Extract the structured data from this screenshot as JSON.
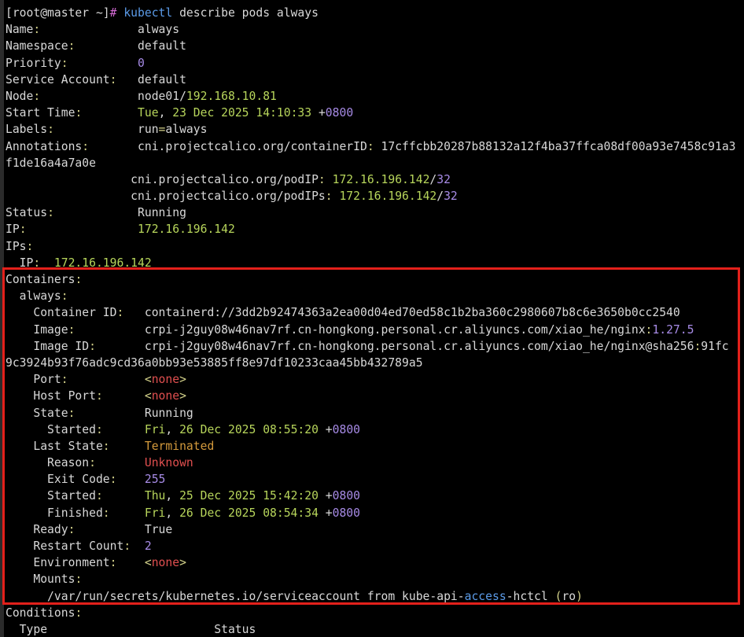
{
  "colors": {
    "background": "#000000",
    "text": "#d8d8d8",
    "label": "#d4d28a",
    "ip_green": "#b7d55b",
    "number_purple": "#a78be6",
    "command_blue": "#5b9be8",
    "terminated_orange": "#d49a3c",
    "unknown_red": "#e04f4f",
    "highlight_box": "#e3201b"
  },
  "terminal": {
    "lines": [
      [
        {
          "t": "[root@master ~]",
          "c": "w"
        },
        {
          "t": "# ",
          "c": "m"
        },
        {
          "t": "kubectl",
          "c": "b"
        },
        {
          "t": " describe pods always",
          "c": "w"
        }
      ],
      [
        {
          "t": "Name",
          "c": "w"
        },
        {
          "t": ":",
          "c": "y"
        },
        {
          "t": "              always",
          "c": "w"
        }
      ],
      [
        {
          "t": "Namespace",
          "c": "w"
        },
        {
          "t": ":",
          "c": "y"
        },
        {
          "t": "         default",
          "c": "w"
        }
      ],
      [
        {
          "t": "Priority",
          "c": "w"
        },
        {
          "t": ":",
          "c": "y"
        },
        {
          "t": "          ",
          "c": "w"
        },
        {
          "t": "0",
          "c": "p"
        }
      ],
      [
        {
          "t": "Service Account",
          "c": "w"
        },
        {
          "t": ":",
          "c": "y"
        },
        {
          "t": "   default",
          "c": "w"
        }
      ],
      [
        {
          "t": "Node",
          "c": "w"
        },
        {
          "t": ":",
          "c": "y"
        },
        {
          "t": "              node01/",
          "c": "w"
        },
        {
          "t": "192.168.10.81",
          "c": "g"
        }
      ],
      [
        {
          "t": "Start Time",
          "c": "w"
        },
        {
          "t": ":",
          "c": "y"
        },
        {
          "t": "        ",
          "c": "w"
        },
        {
          "t": "Tue",
          "c": "g"
        },
        {
          "t": ", ",
          "c": "w"
        },
        {
          "t": "23 Dec 2025 14:10:33",
          "c": "g"
        },
        {
          "t": " +",
          "c": "w"
        },
        {
          "t": "0800",
          "c": "p"
        }
      ],
      [
        {
          "t": "Labels",
          "c": "w"
        },
        {
          "t": ":",
          "c": "y"
        },
        {
          "t": "            run",
          "c": "w"
        },
        {
          "t": "=",
          "c": "y"
        },
        {
          "t": "always",
          "c": "w"
        }
      ],
      [
        {
          "t": "Annotations",
          "c": "w"
        },
        {
          "t": ":",
          "c": "y"
        },
        {
          "t": "       cni.projectcalico.org/containerID",
          "c": "w"
        },
        {
          "t": ": ",
          "c": "y"
        },
        {
          "t": "17cffcbb20287b88132a12f4ba37ffca08df00a93e7458c91a3",
          "c": "w"
        }
      ],
      [
        {
          "t": "f1de16a4a7a0e",
          "c": "w"
        }
      ],
      [
        {
          "t": "                  cni.projectcalico.org/podIP",
          "c": "w"
        },
        {
          "t": ": ",
          "c": "y"
        },
        {
          "t": "172.16.196.142",
          "c": "g"
        },
        {
          "t": "/",
          "c": "w"
        },
        {
          "t": "32",
          "c": "p"
        }
      ],
      [
        {
          "t": "                  cni.projectcalico.org/podIPs",
          "c": "w"
        },
        {
          "t": ": ",
          "c": "y"
        },
        {
          "t": "172.16.196.142",
          "c": "g"
        },
        {
          "t": "/",
          "c": "w"
        },
        {
          "t": "32",
          "c": "p"
        }
      ],
      [
        {
          "t": "Status",
          "c": "w"
        },
        {
          "t": ":",
          "c": "y"
        },
        {
          "t": "            Running",
          "c": "w"
        }
      ],
      [
        {
          "t": "IP",
          "c": "w"
        },
        {
          "t": ":",
          "c": "y"
        },
        {
          "t": "                ",
          "c": "w"
        },
        {
          "t": "172.16.196.142",
          "c": "g"
        }
      ],
      [
        {
          "t": "IPs",
          "c": "w"
        },
        {
          "t": ":",
          "c": "y"
        }
      ],
      [
        {
          "t": "  IP",
          "c": "w"
        },
        {
          "t": ":",
          "c": "y"
        },
        {
          "t": "  ",
          "c": "w"
        },
        {
          "t": "172.16.196.142",
          "c": "g"
        }
      ],
      [
        {
          "t": "Containers",
          "c": "w"
        },
        {
          "t": ":",
          "c": "y"
        }
      ],
      [
        {
          "t": "  always",
          "c": "w"
        },
        {
          "t": ":",
          "c": "y"
        }
      ],
      [
        {
          "t": "    Container ID",
          "c": "w"
        },
        {
          "t": ":",
          "c": "y"
        },
        {
          "t": "   containerd://3dd2b92474363a2ea00d04ed70ed58c1b2ba360c2980607b8c6e3650b0cc2540",
          "c": "w"
        }
      ],
      [
        {
          "t": "    Image",
          "c": "w"
        },
        {
          "t": ":",
          "c": "y"
        },
        {
          "t": "          crpi-j2guy08w46nav7rf.cn-hongkong.personal.cr.aliyuncs.com/xiao_he/nginx",
          "c": "w"
        },
        {
          "t": ":",
          "c": "y"
        },
        {
          "t": "1.27.5",
          "c": "p"
        }
      ],
      [
        {
          "t": "    Image ID",
          "c": "w"
        },
        {
          "t": ":",
          "c": "y"
        },
        {
          "t": "       crpi-j2guy08w46nav7rf.cn-hongkong.personal.cr.aliyuncs.com/xiao_he/nginx@sha256",
          "c": "w"
        },
        {
          "t": ":",
          "c": "y"
        },
        {
          "t": "91fc",
          "c": "w"
        }
      ],
      [
        {
          "t": "9c3924b93f76adc9cd36a0bb93e53885ff8e97df10233caa45bb432789a5",
          "c": "w"
        }
      ],
      [
        {
          "t": "    Port",
          "c": "w"
        },
        {
          "t": ":",
          "c": "y"
        },
        {
          "t": "           ",
          "c": "w"
        },
        {
          "t": "<",
          "c": "y"
        },
        {
          "t": "none",
          "c": "r"
        },
        {
          "t": ">",
          "c": "y"
        }
      ],
      [
        {
          "t": "    Host Port",
          "c": "w"
        },
        {
          "t": ":",
          "c": "y"
        },
        {
          "t": "      ",
          "c": "w"
        },
        {
          "t": "<",
          "c": "y"
        },
        {
          "t": "none",
          "c": "r"
        },
        {
          "t": ">",
          "c": "y"
        }
      ],
      [
        {
          "t": "    State",
          "c": "w"
        },
        {
          "t": ":",
          "c": "y"
        },
        {
          "t": "          Running",
          "c": "w"
        }
      ],
      [
        {
          "t": "      Started",
          "c": "w"
        },
        {
          "t": ":",
          "c": "y"
        },
        {
          "t": "      ",
          "c": "w"
        },
        {
          "t": "Fri",
          "c": "g"
        },
        {
          "t": ", ",
          "c": "w"
        },
        {
          "t": "26 Dec 2025 08:55:20",
          "c": "g"
        },
        {
          "t": " +",
          "c": "w"
        },
        {
          "t": "0800",
          "c": "p"
        }
      ],
      [
        {
          "t": "    Last State",
          "c": "w"
        },
        {
          "t": ":",
          "c": "y"
        },
        {
          "t": "     ",
          "c": "w"
        },
        {
          "t": "Terminated",
          "c": "o"
        }
      ],
      [
        {
          "t": "      Reason",
          "c": "w"
        },
        {
          "t": ":",
          "c": "y"
        },
        {
          "t": "       ",
          "c": "w"
        },
        {
          "t": "Unknown",
          "c": "r"
        }
      ],
      [
        {
          "t": "      Exit Code",
          "c": "w"
        },
        {
          "t": ":",
          "c": "y"
        },
        {
          "t": "    ",
          "c": "w"
        },
        {
          "t": "255",
          "c": "p"
        }
      ],
      [
        {
          "t": "      Started",
          "c": "w"
        },
        {
          "t": ":",
          "c": "y"
        },
        {
          "t": "      ",
          "c": "w"
        },
        {
          "t": "Thu",
          "c": "g"
        },
        {
          "t": ", ",
          "c": "w"
        },
        {
          "t": "25 Dec 2025 15:42:20",
          "c": "g"
        },
        {
          "t": " +",
          "c": "w"
        },
        {
          "t": "0800",
          "c": "p"
        }
      ],
      [
        {
          "t": "      Finished",
          "c": "w"
        },
        {
          "t": ":",
          "c": "y"
        },
        {
          "t": "     ",
          "c": "w"
        },
        {
          "t": "Fri",
          "c": "g"
        },
        {
          "t": ", ",
          "c": "w"
        },
        {
          "t": "26 Dec 2025 08:54:34",
          "c": "g"
        },
        {
          "t": " +",
          "c": "w"
        },
        {
          "t": "0800",
          "c": "p"
        }
      ],
      [
        {
          "t": "    Ready",
          "c": "w"
        },
        {
          "t": ":",
          "c": "y"
        },
        {
          "t": "          True",
          "c": "w"
        }
      ],
      [
        {
          "t": "    Restart Count",
          "c": "w"
        },
        {
          "t": ":",
          "c": "y"
        },
        {
          "t": "  ",
          "c": "w"
        },
        {
          "t": "2",
          "c": "p"
        }
      ],
      [
        {
          "t": "    Environment",
          "c": "w"
        },
        {
          "t": ":",
          "c": "y"
        },
        {
          "t": "    ",
          "c": "w"
        },
        {
          "t": "<",
          "c": "y"
        },
        {
          "t": "none",
          "c": "r"
        },
        {
          "t": ">",
          "c": "y"
        }
      ],
      [
        {
          "t": "    Mounts",
          "c": "w"
        },
        {
          "t": ":",
          "c": "y"
        }
      ],
      [
        {
          "t": "      /var/run/secrets/kubernetes.io/serviceaccount from kube-api-",
          "c": "w"
        },
        {
          "t": "access",
          "c": "b"
        },
        {
          "t": "-hctcl ",
          "c": "w"
        },
        {
          "t": "(",
          "c": "y"
        },
        {
          "t": "ro",
          "c": "w"
        },
        {
          "t": ")",
          "c": "y"
        }
      ],
      [
        {
          "t": "Conditions",
          "c": "w"
        },
        {
          "t": ":",
          "c": "y"
        }
      ],
      [
        {
          "t": "  Type                        Status",
          "c": "w"
        }
      ]
    ]
  }
}
